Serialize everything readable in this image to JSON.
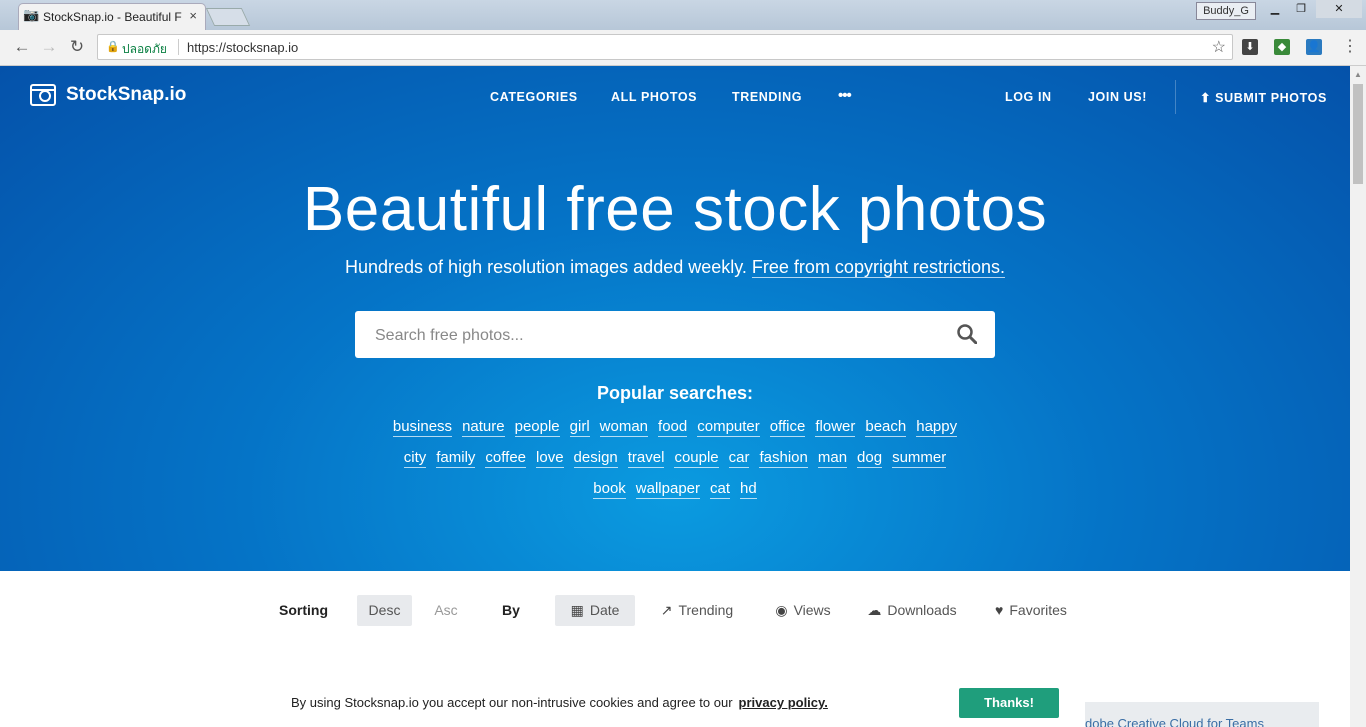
{
  "browser": {
    "tab_title": "StockSnap.io - Beautiful F",
    "tab_close": "×",
    "profile_name": "Buddy_G",
    "secure_label": "ปลอดภัย",
    "url": "https://stocksnap.io"
  },
  "site": {
    "logo_text": "StockSnap.io",
    "nav": {
      "categories": "CATEGORIES",
      "all_photos": "ALL PHOTOS",
      "trending": "TRENDING",
      "more": "•••",
      "login": "LOG IN",
      "join": "JOIN US!",
      "submit": "SUBMIT PHOTOS"
    },
    "hero": {
      "title": "Beautiful free stock photos",
      "subtitle": "Hundreds of high resolution images added weekly.",
      "subtitle_link": "Free from copyright restrictions.",
      "search_placeholder": "Search free photos...",
      "popular_title": "Popular searches:",
      "tags_row1": [
        "business",
        "nature",
        "people",
        "girl",
        "woman",
        "food",
        "computer",
        "office",
        "flower",
        "beach",
        "happy"
      ],
      "tags_row2": [
        "city",
        "family",
        "coffee",
        "love",
        "design",
        "travel",
        "couple",
        "car",
        "fashion",
        "man",
        "dog",
        "summer"
      ],
      "tags_row3": [
        "book",
        "wallpaper",
        "cat",
        "hd"
      ]
    },
    "sorting": {
      "sorting_label": "Sorting",
      "desc": "Desc",
      "asc": "Asc",
      "by_label": "By",
      "date": "Date",
      "trending": "Trending",
      "views": "Views",
      "downloads": "Downloads",
      "favorites": "Favorites"
    },
    "cookie": {
      "text": "By using Stocksnap.io you accept our non-intrusive cookies and agree to our",
      "link": "privacy policy.",
      "button": "Thanks!"
    },
    "ad_text": "dobe Creative Cloud for Teams"
  }
}
